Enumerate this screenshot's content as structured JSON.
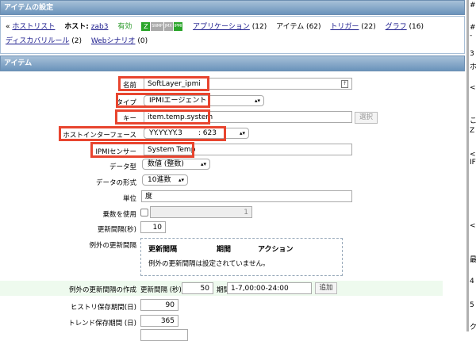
{
  "window_title": "アイテムの設定",
  "nav": {
    "back_prefix": "«",
    "host_list": "ホストリスト",
    "host_label": "ホスト:",
    "host_name": "zab3",
    "status": "有効",
    "status_icons": [
      {
        "text": "Z",
        "color": "#2aa52a"
      },
      {
        "text": "SNMP",
        "color": "#aaaaaa"
      },
      {
        "text": "JMX",
        "color": "#aaaaaa"
      },
      {
        "text": "IPMI",
        "color": "#2aa52a"
      }
    ],
    "applications": "アプリケーション",
    "applications_count": "(12)",
    "items": "アイテム (62)",
    "triggers": "トリガー",
    "triggers_count": "(22)",
    "graphs": "グラフ",
    "graphs_count": "(16)",
    "discovery": "ディスカバリルール",
    "discovery_count": "(2)",
    "web": "Webシナリオ",
    "web_count": "(0)"
  },
  "section_title": "アイテム",
  "form": {
    "name_label": "名前",
    "name_value": "SoftLayer_ipmi",
    "type_label": "タイプ",
    "type_value": "IPMIエージェント",
    "key_label": "キー",
    "key_value": "item.temp.system",
    "select_button": "選択",
    "interface_label": "ホストインターフェース",
    "interface_ip": "YY.YY.YY.3",
    "interface_port": ": 623",
    "ipmi_sensor_label": "IPMIセンサー",
    "ipmi_sensor_value": "System Temp",
    "data_type_label": "データ型",
    "data_type_value": "数値 (整数)",
    "data_format_label": "データの形式",
    "data_format_value": "10進数",
    "unit_label": "単位",
    "unit_value": "度",
    "multiplier_label": "乗数を使用",
    "multiplier_value": "1",
    "interval_label": "更新間隔(秒)",
    "interval_value": "10",
    "flex_label": "例外の更新間隔",
    "flex_headers": [
      "更新間隔",
      "期間",
      "アクション"
    ],
    "flex_empty": "例外の更新間隔は設定されていません。",
    "new_flex_label": "例外の更新間隔の作成",
    "new_flex_interval_label": "更新間隔 (秒)",
    "new_flex_interval_value": "50",
    "new_flex_period_label": "期間",
    "new_flex_period_value": "1-7,00:00-24:00",
    "add_button": "追加",
    "history_label": "ヒストリ保存期間(日)",
    "history_value": "90",
    "trends_label": "トレンド保存期間 (日)",
    "trends_value": "365"
  },
  "right_fragments": [
    "#",
    "#",
    "-",
    "3",
    "ホ",
    "<",
    "こ",
    "Z",
    "<",
    "IF",
    "<",
    "最",
    "4",
    "5",
    "ク"
  ],
  "colors": {
    "highlight": "#e8452f",
    "header": "#6a93bb",
    "new_flex_bg": "#eefaee"
  }
}
